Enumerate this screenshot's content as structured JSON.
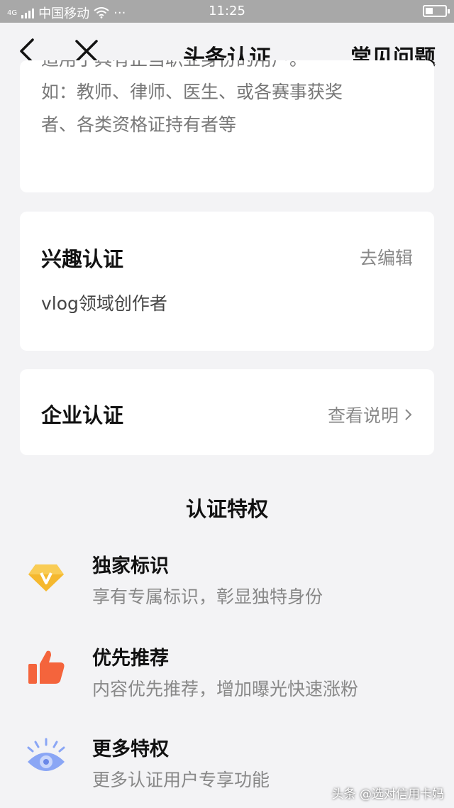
{
  "status_bar": {
    "carrier": "中国移动",
    "time": "11:25",
    "network": "4G"
  },
  "nav": {
    "title": "头条认证",
    "faq_label": "常见问题",
    "back_icon": "chevron-left-icon",
    "close_icon": "close-icon"
  },
  "cards": {
    "partial": {
      "line1": "适用于具有正当职业身份的用户。",
      "line2": "如：教师、律师、医生、或各赛事获奖",
      "line3": "者、各类资格证持有者等"
    },
    "interest": {
      "title": "兴趣认证",
      "action": "去编辑",
      "value": "vlog领域创作者"
    },
    "enterprise": {
      "title": "企业认证",
      "action": "查看说明",
      "chevron_icon": "chevron-right-icon"
    }
  },
  "privileges": {
    "title": "认证特权",
    "items": [
      {
        "title": "独家标识",
        "desc": "享有专属标识，彰显独特身份",
        "icon": "diamond-badge-icon",
        "color": "#f5b82e"
      },
      {
        "title": "优先推荐",
        "desc": "内容优先推荐，增加曝光快速涨粉",
        "icon": "thumbs-up-icon",
        "color": "#f4643c"
      },
      {
        "title": "更多特权",
        "desc": "更多认证用户专享功能",
        "icon": "eye-icon",
        "color": "#8aa6f5"
      }
    ]
  },
  "watermark": "头条 @选对信用卡妈"
}
